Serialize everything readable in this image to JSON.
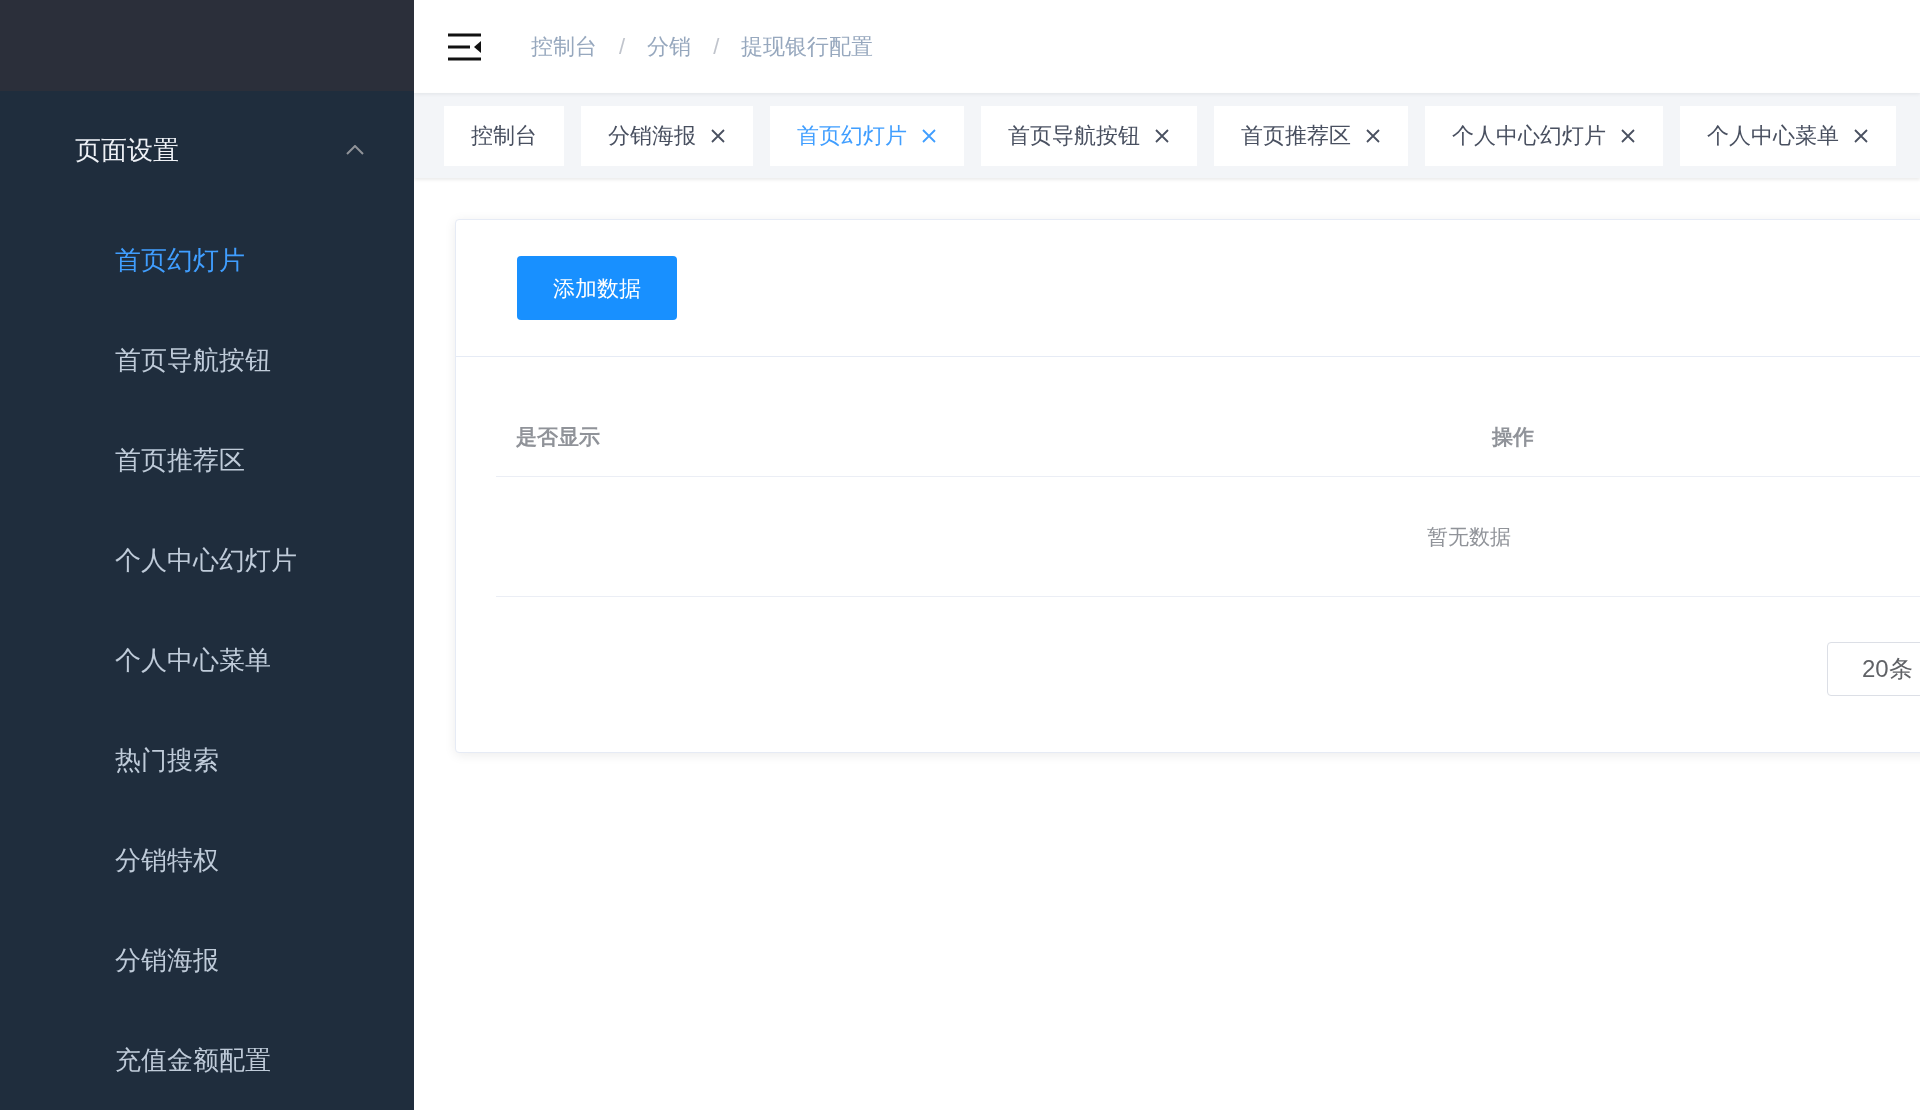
{
  "breadcrumb": {
    "separator": "/",
    "items": [
      "控制台",
      "分销",
      "提现银行配置"
    ]
  },
  "sidebar": {
    "group": {
      "label": "页面设置",
      "expanded": true
    },
    "items": [
      {
        "label": "首页幻灯片",
        "selected": true
      },
      {
        "label": "首页导航按钮",
        "selected": false
      },
      {
        "label": "首页推荐区",
        "selected": false
      },
      {
        "label": "个人中心幻灯片",
        "selected": false
      },
      {
        "label": "个人中心菜单",
        "selected": false
      },
      {
        "label": "热门搜索",
        "selected": false
      },
      {
        "label": "分销特权",
        "selected": false
      },
      {
        "label": "分销海报",
        "selected": false
      },
      {
        "label": "充值金额配置",
        "selected": false
      }
    ]
  },
  "tabs": [
    {
      "label": "控制台",
      "selected": false,
      "closable": false
    },
    {
      "label": "分销海报",
      "selected": false,
      "closable": true
    },
    {
      "label": "首页幻灯片",
      "selected": true,
      "closable": true
    },
    {
      "label": "首页导航按钮",
      "selected": false,
      "closable": true
    },
    {
      "label": "首页推荐区",
      "selected": false,
      "closable": true
    },
    {
      "label": "个人中心幻灯片",
      "selected": false,
      "closable": true
    },
    {
      "label": "个人中心菜单",
      "selected": false,
      "closable": true
    }
  ],
  "add_button": "添加数据",
  "table": {
    "columns": [
      "是否显示",
      "操作"
    ],
    "empty_text": "暂无数据"
  },
  "pagination": {
    "page_size": "20条"
  }
}
